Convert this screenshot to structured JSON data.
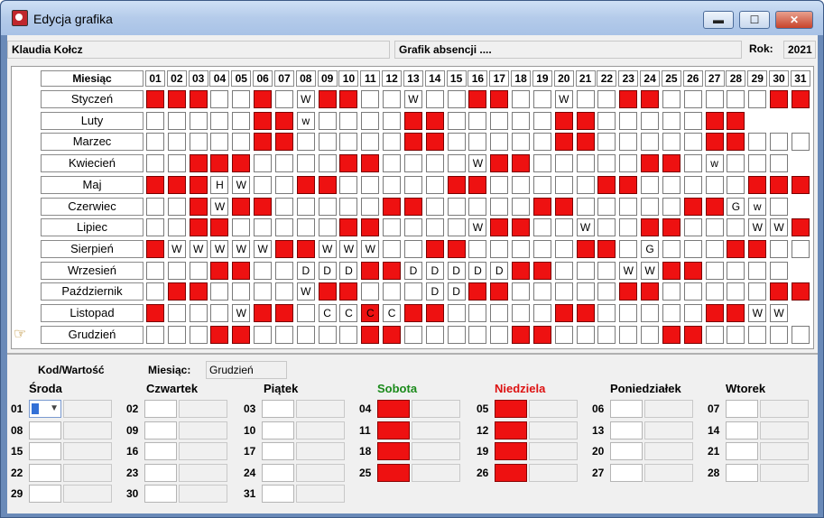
{
  "window": {
    "title": "Edycja grafika",
    "btn_minimize": "▬",
    "btn_maximize": "☐",
    "btn_close": "✕"
  },
  "header": {
    "employee": "Klaudia Kołcz",
    "schedule": "Grafik absencji ....",
    "year_label": "Rok:",
    "year": "2021"
  },
  "calendar": {
    "month_header": "Miesiąc",
    "days": [
      "01",
      "02",
      "03",
      "04",
      "05",
      "06",
      "07",
      "08",
      "09",
      "10",
      "11",
      "12",
      "13",
      "14",
      "15",
      "16",
      "17",
      "18",
      "19",
      "20",
      "21",
      "22",
      "23",
      "24",
      "25",
      "26",
      "27",
      "28",
      "29",
      "30",
      "31"
    ],
    "months": [
      {
        "name": "Styczeń",
        "days": 31,
        "red": [
          1,
          2,
          3,
          6,
          9,
          10,
          16,
          17,
          23,
          24,
          30,
          31
        ],
        "text": {
          "8": "W",
          "13": "W",
          "20": "W"
        }
      },
      {
        "name": "Luty",
        "days": 28,
        "red": [
          6,
          7,
          13,
          14,
          20,
          21,
          27,
          28
        ],
        "text": {
          "8": "w"
        }
      },
      {
        "name": "Marzec",
        "days": 31,
        "red": [
          6,
          7,
          13,
          14,
          20,
          21,
          27,
          28
        ],
        "text": {}
      },
      {
        "name": "Kwiecień",
        "days": 30,
        "red": [
          3,
          4,
          5,
          10,
          11,
          17,
          18,
          24,
          25
        ],
        "text": {
          "16": "W",
          "27": "w"
        }
      },
      {
        "name": "Maj",
        "days": 31,
        "red": [
          1,
          2,
          3,
          8,
          9,
          15,
          16,
          22,
          23,
          29,
          30,
          31
        ],
        "text": {
          "4": "H",
          "5": "W"
        }
      },
      {
        "name": "Czerwiec",
        "days": 30,
        "red": [
          3,
          5,
          6,
          12,
          13,
          19,
          20,
          26,
          27
        ],
        "text": {
          "4": "W",
          "28": "G",
          "29": "w"
        }
      },
      {
        "name": "Lipiec",
        "days": 31,
        "red": [
          3,
          4,
          10,
          11,
          17,
          18,
          24,
          25,
          31
        ],
        "text": {
          "16": "W",
          "21": "W",
          "29": "W",
          "30": "W"
        }
      },
      {
        "name": "Sierpień",
        "days": 31,
        "red": [
          1,
          7,
          8,
          14,
          15,
          21,
          22,
          28,
          29
        ],
        "text": {
          "2": "W",
          "3": "W",
          "4": "W",
          "5": "W",
          "6": "W",
          "9": "W",
          "10": "W",
          "11": "W",
          "24": "G"
        }
      },
      {
        "name": "Wrzesień",
        "days": 30,
        "red": [
          4,
          5,
          11,
          12,
          18,
          19,
          25,
          26
        ],
        "text": {
          "8": "D",
          "9": "D",
          "10": "D",
          "13": "D",
          "14": "D",
          "15": "D",
          "16": "D",
          "17": "D",
          "23": "W",
          "24": "W"
        }
      },
      {
        "name": "Październik",
        "days": 31,
        "red": [
          2,
          3,
          9,
          10,
          16,
          17,
          23,
          24,
          30,
          31
        ],
        "text": {
          "8": "W",
          "14": "D",
          "15": "D"
        }
      },
      {
        "name": "Listopad",
        "days": 30,
        "red": [
          1,
          6,
          7,
          11,
          13,
          14,
          20,
          21,
          27,
          28
        ],
        "text": {
          "5": "W",
          "9": "C",
          "10": "C",
          "11": "C",
          "12": "C",
          "29": "W",
          "30": "W"
        }
      },
      {
        "name": "Grudzień",
        "days": 31,
        "red": [
          4,
          5,
          11,
          12,
          18,
          19,
          25,
          26
        ],
        "text": {}
      }
    ]
  },
  "editor": {
    "code_label": "Kod/Wartość",
    "month_label": "Miesiąc:",
    "month_value": "Grudzień",
    "weekdays": [
      "Środa",
      "Czwartek",
      "Piątek",
      "Sobota",
      "Niedziela",
      "Poniedziałek",
      "Wtorek"
    ],
    "colors": {
      "saturday": "#1a8a1a",
      "sunday": "#dd1111",
      "weekend_fill": "#ee1111"
    },
    "columns": [
      [
        "01",
        "08",
        "15",
        "22",
        "29"
      ],
      [
        "02",
        "09",
        "16",
        "23",
        "30"
      ],
      [
        "03",
        "10",
        "17",
        "24",
        "31"
      ],
      [
        "04",
        "11",
        "18",
        "25"
      ],
      [
        "05",
        "12",
        "19",
        "26"
      ],
      [
        "06",
        "13",
        "20",
        "27"
      ],
      [
        "07",
        "14",
        "21",
        "28"
      ]
    ]
  }
}
